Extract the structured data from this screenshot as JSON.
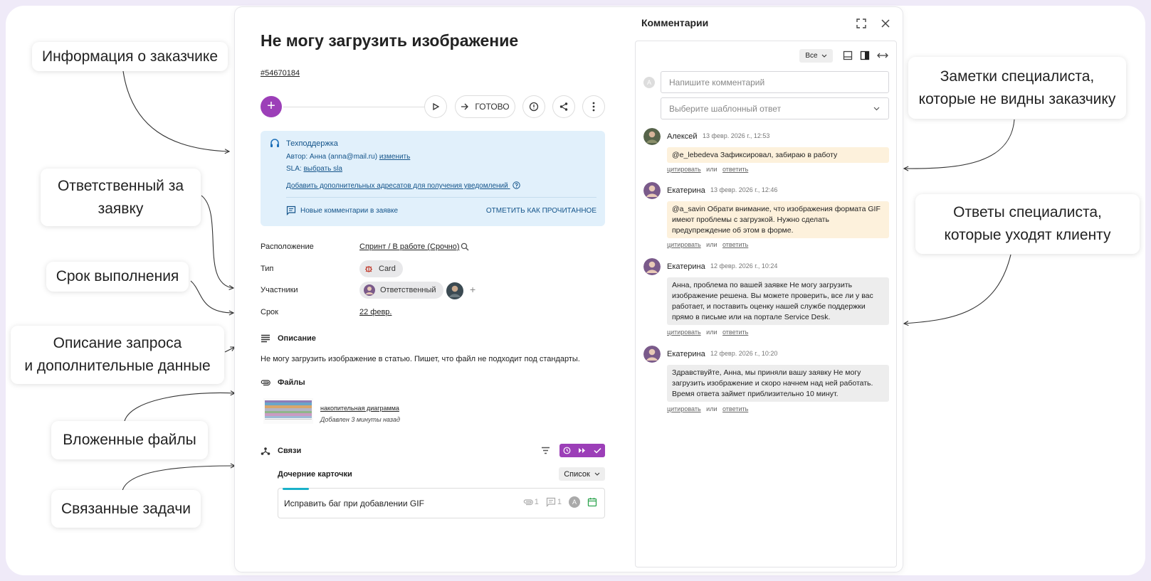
{
  "callouts": {
    "customer_info": "Информация о заказчике",
    "responsible": "Ответственный за\nзаявку",
    "due_date": "Срок выполнения",
    "description": "Описание запроса\nи дополнительные данные",
    "attachments": "Вложенные файлы",
    "related_tasks": "Связанные задачи",
    "specialist_notes": "Заметки специалиста,\nкоторые не видны заказчику",
    "specialist_replies": "Ответы специалиста,\nкоторые уходят клиенту"
  },
  "ticket": {
    "title": "Не могу загрузить изображение",
    "id": "#54670184",
    "toolbar": {
      "add": "+",
      "done": "ГОТОВО"
    },
    "info": {
      "service": "Техподдержка",
      "author_prefix": "Автор: Анна (anna@mail.ru)",
      "author_change": "изменить",
      "sla_prefix": "SLA:",
      "sla_link": "выбрать sla",
      "add_addresses": "Добавить дополнительных адресатов для получения уведомлений",
      "new_comments": "Новые комментарии в заявке",
      "mark_read": "ОТМЕТИТЬ КАК ПРОЧИТАННОЕ"
    },
    "fields": {
      "location_label": "Расположение",
      "location_value": "Спринт / В работе (Срочно)",
      "type_label": "Тип",
      "type_value": "Card",
      "participants_label": "Участники",
      "participants_value": "Ответственный",
      "due_label": "Срок",
      "due_value": "22 февр."
    },
    "description": {
      "heading": "Описание",
      "text": "Не могу загрузить изображение в статью. Пишет, что файл не подходит под стандарты."
    },
    "files": {
      "heading": "Файлы",
      "name": "накопительная диаграмма",
      "added": "Добавлен 3 минуты назад"
    },
    "links": {
      "heading": "Связи",
      "children_label": "Дочерние карточки",
      "list_button": "Список",
      "child_title": "Исправить баг при добавлении GIF",
      "child_attachments": "1",
      "child_comments": "1",
      "child_avatar": "A"
    }
  },
  "comments": {
    "title": "Комментарии",
    "filter": "Все",
    "input_placeholder": "Напишите комментарий",
    "template_placeholder": "Выберите шаблонный ответ",
    "avatar_letter": "A",
    "action_quote": "цитировать",
    "action_or": "или",
    "action_reply": "ответить",
    "items": [
      {
        "author": "Алексей",
        "date": "13 февр. 2026 г., 12:53",
        "text": "@e_lebedeva Зафиксировал, забираю в работу",
        "kind": "note"
      },
      {
        "author": "Екатерина",
        "date": "13 февр. 2026 г., 12:46",
        "text": "@a_savin Обрати внимание, что изображения формата GIF имеют проблемы с загрузкой. Нужно сделать предупреждение об этом в форме.",
        "kind": "note"
      },
      {
        "author": "Екатерина",
        "date": "12 февр. 2026 г., 10:24",
        "text": "Анна, проблема по вашей заявке Не могу загрузить изображение решена. Вы можете проверить, все ли у вас работает, и поставить оценку нашей службе поддержки прямо в письме или на портале Service Desk.",
        "kind": "reply"
      },
      {
        "author": "Екатерина",
        "date": "12 февр. 2026 г., 10:20",
        "text": "Здравствуйте, Анна, мы приняли вашу заявку Не могу загрузить изображение и скоро начнем над ней работать. Время ответа займет приблизительно 10 минут.",
        "kind": "reply"
      }
    ]
  },
  "colors": {
    "accent": "#9c3fb8",
    "info_bg": "#e1f0fb",
    "note_bg": "#fdf1dc",
    "reply_bg": "#ededed",
    "teal": "#1ab1c9"
  }
}
